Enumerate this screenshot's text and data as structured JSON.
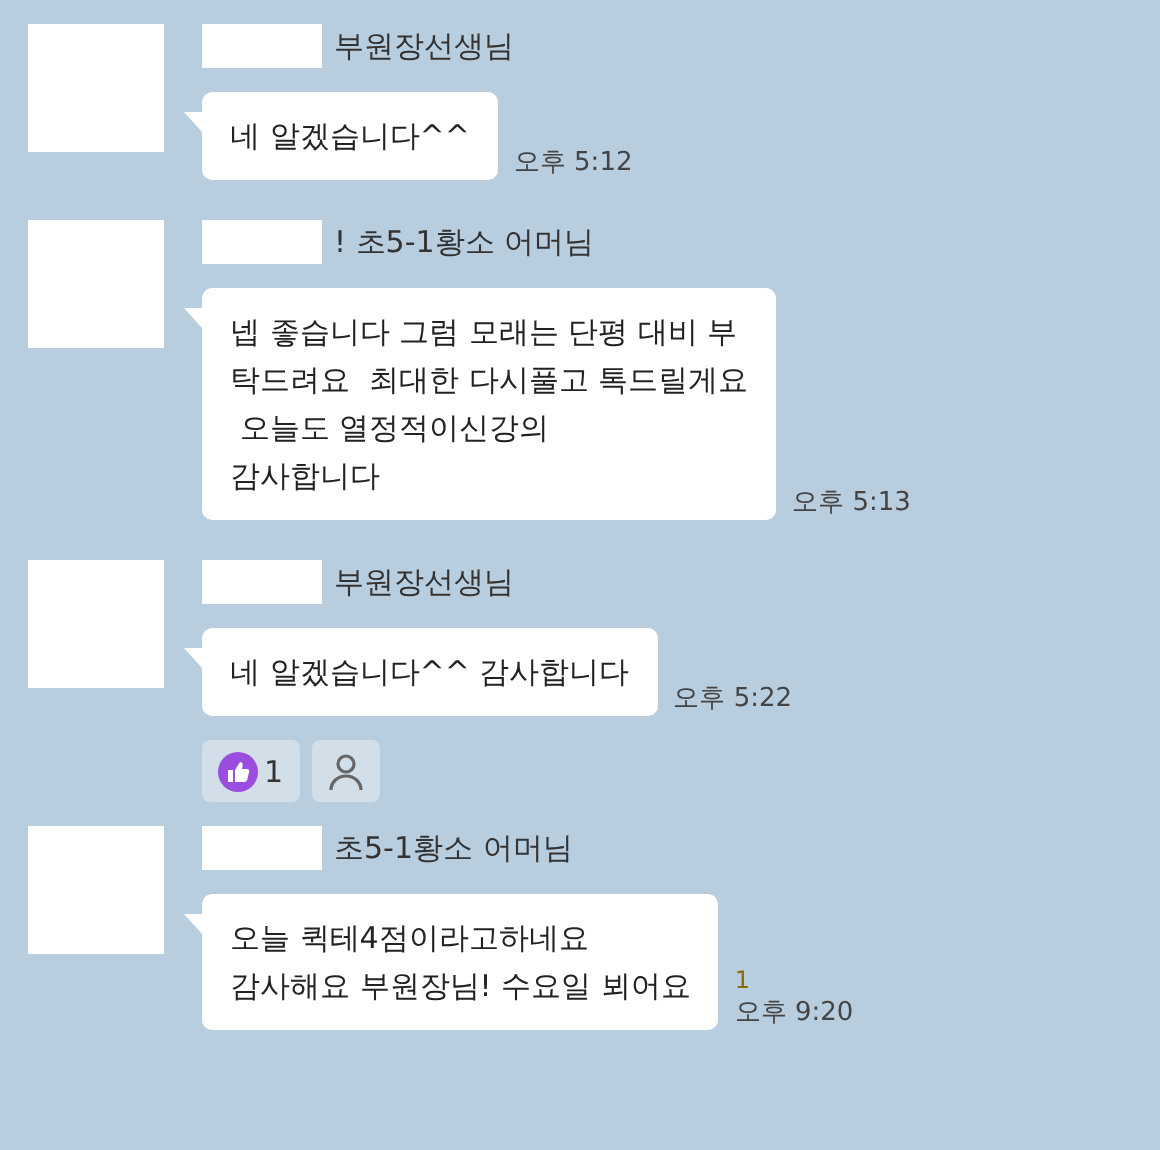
{
  "messages": [
    {
      "sender": "부원장선생님",
      "text": "네 알겠습니다^^",
      "time": "오후 5:12"
    },
    {
      "sender": "! 초5-1황소 어머님",
      "text": "넵 좋습니다 그럼 모래는 단평 대비 부\n탁드려요  최대한 다시풀고 톡드릴게요\n 오늘도 열정적이신강의\n감사합니다",
      "time": "오후 5:13"
    },
    {
      "sender": "부원장선생님",
      "text": "네 알겠습니다^^ 감사합니다",
      "time": "오후 5:22",
      "reactions": [
        {
          "kind": "like",
          "count": "1"
        },
        {
          "kind": "add"
        }
      ]
    },
    {
      "sender": "초5-1황소 어머님",
      "text": "오늘 퀵테4점이라고하네요\n감사해요 부원장님! 수요일 뵈어요",
      "time": "오후 9:20",
      "unread": "1"
    }
  ]
}
